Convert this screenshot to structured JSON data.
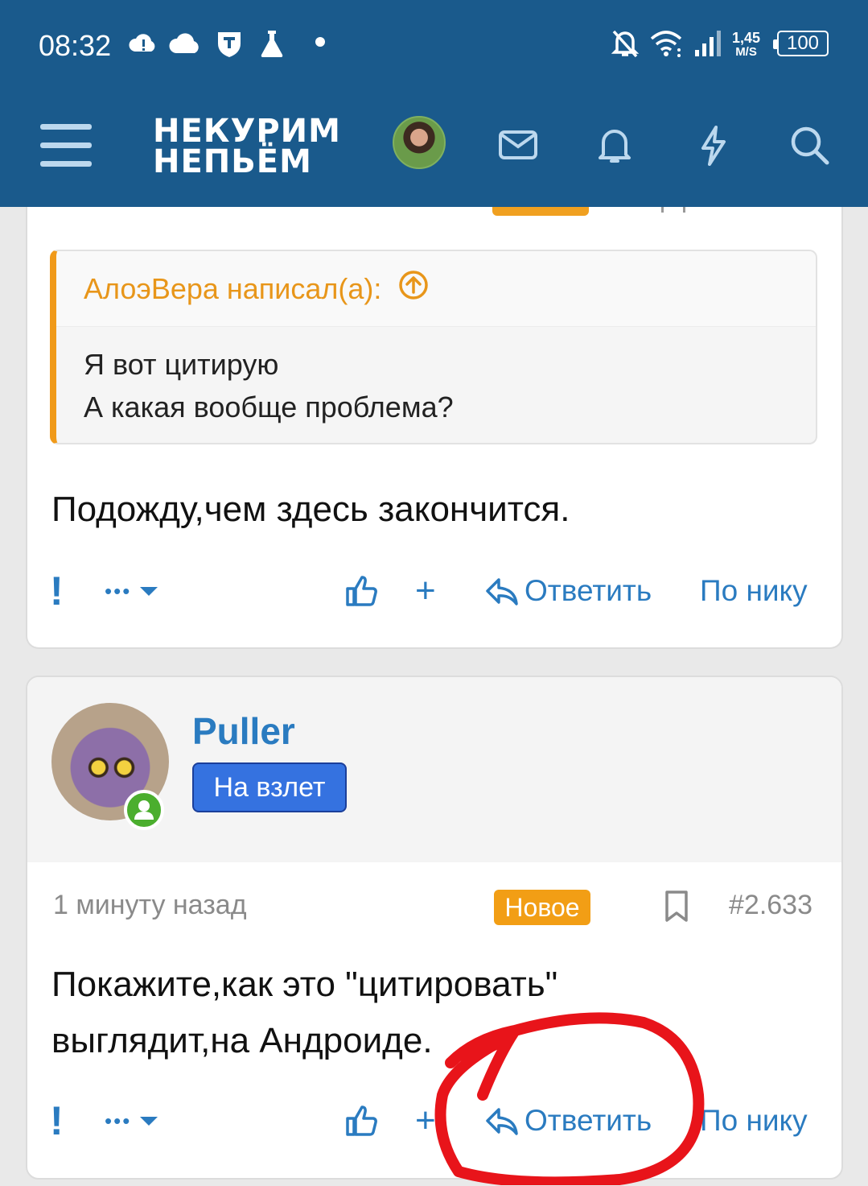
{
  "status_bar": {
    "time": "08:32",
    "net_speed_value": "1,45",
    "net_speed_unit": "M/S",
    "battery": "100"
  },
  "header": {
    "logo_line1": "НЕКУРИМ",
    "logo_line2": "НЕПЬЁМ"
  },
  "post1": {
    "quote_author": "АлоэВера написал(а):",
    "quote_lines": [
      "Я вот цитирую",
      "А какая вообще проблема?"
    ],
    "text": "Подожду,чем здесь закончится.",
    "actions": {
      "report": "!",
      "more": "•••",
      "plus": "+",
      "reply": "Ответить",
      "by_nick": "По нику"
    }
  },
  "post2": {
    "username": "Puller",
    "rank": "На взлет",
    "time": "1 минуту назад",
    "badge": "Новое",
    "number": "#2.633",
    "text_line1": "Покажите,как это \"цитировать\"",
    "text_line2": "выглядит,на Андроиде.",
    "actions": {
      "report": "!",
      "more": "•••",
      "plus": "+",
      "reply": "Ответить",
      "by_nick": "По нику"
    }
  },
  "colors": {
    "header_bg": "#1a5a8c",
    "link": "#2a7bc0",
    "quote_accent": "#f09a1a",
    "badge_new": "#f29e15",
    "rank_bg": "#3572e0",
    "annotation": "#e8141a"
  }
}
